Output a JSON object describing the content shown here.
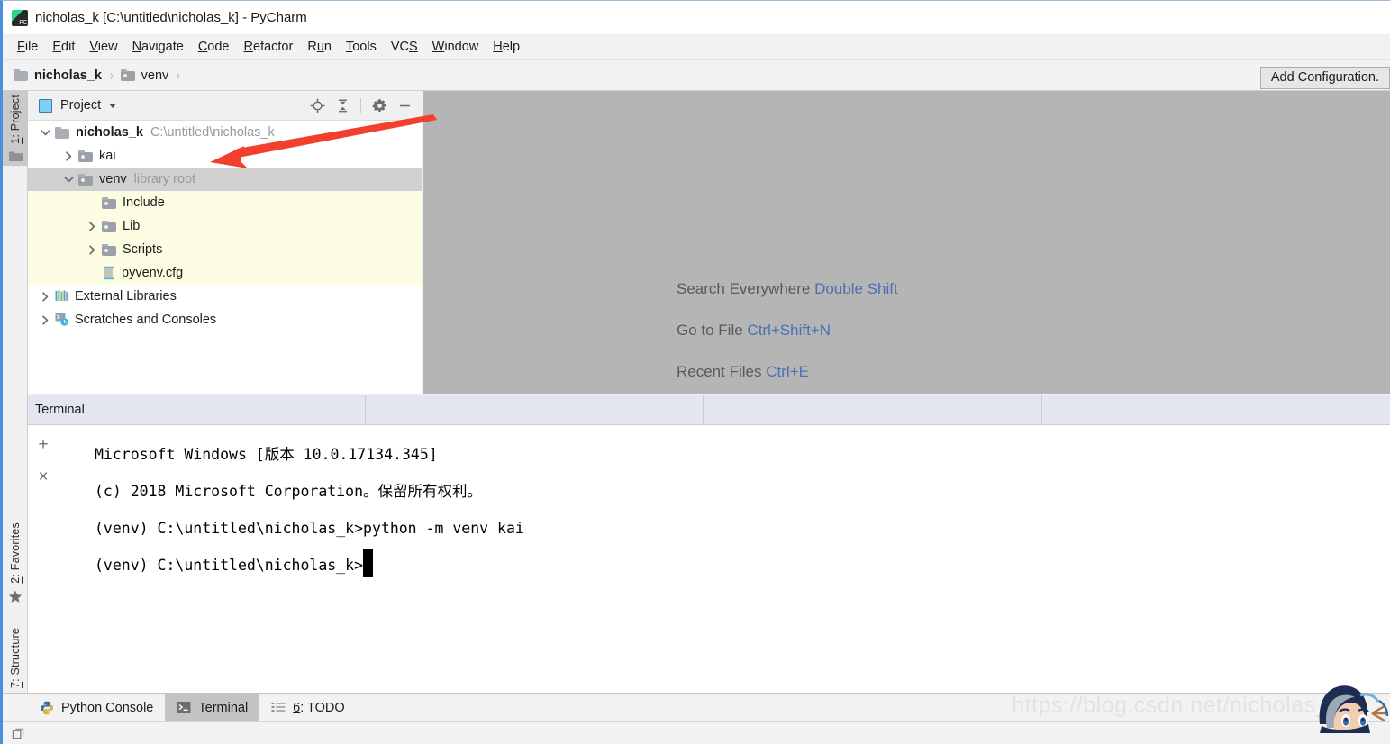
{
  "window": {
    "title": "nicholas_k [C:\\untitled\\nicholas_k] - PyCharm",
    "logo_icon": "pycharm-logo-icon"
  },
  "menubar": {
    "items": [
      {
        "label": "File",
        "mnemonic": "F"
      },
      {
        "label": "Edit",
        "mnemonic": "E"
      },
      {
        "label": "View",
        "mnemonic": "V"
      },
      {
        "label": "Navigate",
        "mnemonic": "N"
      },
      {
        "label": "Code",
        "mnemonic": "C"
      },
      {
        "label": "Refactor",
        "mnemonic": "R"
      },
      {
        "label": "Run",
        "mnemonic": "u"
      },
      {
        "label": "Tools",
        "mnemonic": "T"
      },
      {
        "label": "VCS",
        "mnemonic": "S"
      },
      {
        "label": "Window",
        "mnemonic": "W"
      },
      {
        "label": "Help",
        "mnemonic": "H"
      }
    ]
  },
  "navbar": {
    "crumbs": [
      {
        "label": "nicholas_k",
        "icon": "folder-icon",
        "bold": true
      },
      {
        "label": "venv",
        "icon": "folder-library-icon",
        "bold": false
      }
    ],
    "separator": "›",
    "add_configuration_label": "Add Configuration."
  },
  "left_tool_strip": {
    "tabs": [
      {
        "label": "1: Project",
        "mnemonic": "1",
        "icon": "project-folder-icon",
        "active": true
      },
      {
        "label": "2: Favorites",
        "mnemonic": "2",
        "icon": "star-icon",
        "active": false
      },
      {
        "label": "7: Structure",
        "mnemonic": "7",
        "icon": "structure-icon",
        "active": false
      }
    ]
  },
  "project_panel": {
    "title": "Project",
    "title_icon": "project-window-icon",
    "dropdown_icon": "chevron-down-icon",
    "tools": [
      {
        "name": "locate-icon",
        "title": "Select Opened File"
      },
      {
        "name": "collapse-all-icon",
        "title": "Collapse All"
      },
      {
        "name": "gear-icon",
        "title": "Settings"
      },
      {
        "name": "minimize-icon",
        "title": "Hide"
      }
    ],
    "tree": [
      {
        "label": "nicholas_k",
        "suffix": "C:\\untitled\\nicholas_k",
        "icon": "folder-icon",
        "indent": 0,
        "twisty": "expanded",
        "bold": true,
        "state": "normal"
      },
      {
        "label": "kai",
        "suffix": "",
        "icon": "folder-library-icon",
        "indent": 1,
        "twisty": "collapsed",
        "bold": false,
        "state": "normal"
      },
      {
        "label": "venv",
        "suffix": "library root",
        "icon": "folder-library-icon",
        "indent": 1,
        "twisty": "expanded",
        "bold": false,
        "state": "selected"
      },
      {
        "label": "Include",
        "suffix": "",
        "icon": "folder-library-icon",
        "indent": 2,
        "twisty": "none",
        "bold": false,
        "state": "venvchild"
      },
      {
        "label": "Lib",
        "suffix": "",
        "icon": "folder-library-icon",
        "indent": 2,
        "twisty": "collapsed",
        "bold": false,
        "state": "venvchild"
      },
      {
        "label": "Scripts",
        "suffix": "",
        "icon": "folder-library-icon",
        "indent": 2,
        "twisty": "collapsed",
        "bold": false,
        "state": "venvchild"
      },
      {
        "label": "pyvenv.cfg",
        "suffix": "",
        "icon": "config-file-icon",
        "indent": 2,
        "twisty": "none",
        "bold": false,
        "state": "venvchild"
      },
      {
        "label": "External Libraries",
        "suffix": "",
        "icon": "external-libraries-icon",
        "indent": 0,
        "twisty": "collapsed",
        "bold": false,
        "state": "normal"
      },
      {
        "label": "Scratches and Consoles",
        "suffix": "",
        "icon": "scratches-icon",
        "indent": 0,
        "twisty": "collapsed",
        "bold": false,
        "state": "normal"
      }
    ]
  },
  "editor": {
    "hints": [
      {
        "action": "Search Everywhere",
        "shortcut": "Double Shift"
      },
      {
        "action": "Go to File",
        "shortcut": "Ctrl+Shift+N"
      },
      {
        "action": "Recent Files",
        "shortcut": "Ctrl+E"
      }
    ]
  },
  "annotation": {
    "arrow_color": "#f2402f",
    "points_to": "kai"
  },
  "terminal": {
    "header_title": "Terminal",
    "side_buttons": [
      {
        "name": "new-session-icon",
        "glyph": "+"
      },
      {
        "name": "close-session-icon",
        "glyph": "×"
      }
    ],
    "lines": [
      "Microsoft Windows [版本 10.0.17134.345]",
      "(c) 2018 Microsoft Corporation。保留所有权利。",
      "",
      "(venv) C:\\untitled\\nicholas_k>python -m venv kai",
      "",
      "(venv) C:\\untitled\\nicholas_k>"
    ],
    "prompt_cursor": true
  },
  "bottom_tabs": [
    {
      "label": "Python Console",
      "mnemonic": "",
      "icon": "python-icon",
      "active": false
    },
    {
      "label": "Terminal",
      "mnemonic": "",
      "icon": "terminal-icon",
      "active": true
    },
    {
      "label": "6: TODO",
      "mnemonic": "6",
      "icon": "todo-icon",
      "active": false
    }
  ],
  "statusbar": {
    "icon": "toggle-toolwindow-icon"
  },
  "watermark": {
    "text": "https://blog.csdn.net/nicholas_k",
    "avatar_icon": "anime-avatar-icon"
  },
  "colors": {
    "accent_blue": "#4a6fb5",
    "selection_gray": "#d0d0d0",
    "venv_yellow": "#fdfde3",
    "editor_gray": "#b5b5b5",
    "arrow_red": "#f2402f",
    "terminal_bg": "#ffffff"
  }
}
